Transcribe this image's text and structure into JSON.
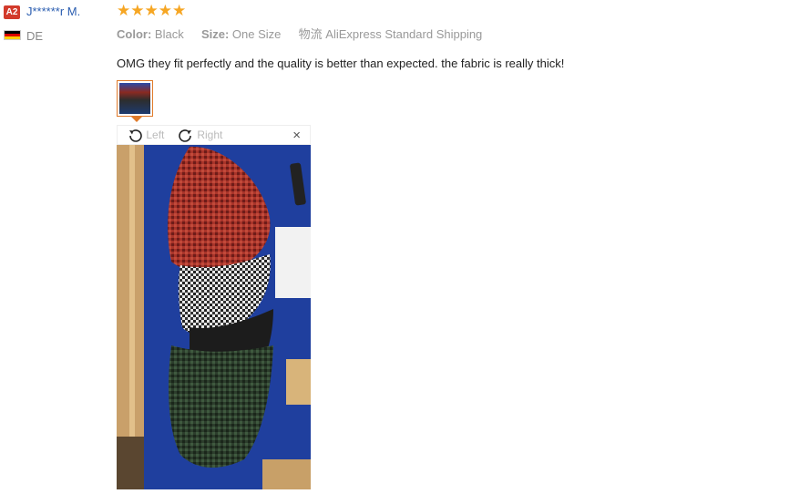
{
  "reviewer": {
    "level_badge": "A2",
    "name": "J******r M.",
    "country_code": "DE"
  },
  "rating": {
    "stars": 5,
    "max": 5,
    "star_color": "#f6a623"
  },
  "meta": {
    "color_label": "Color:",
    "color_value": "Black",
    "size_label": "Size:",
    "size_value": "One Size",
    "shipping_label": "物流",
    "shipping_value": "AliExpress Standard Shipping"
  },
  "review_text": "OMG they fit perfectly and the quality is better than expected. the fabric is really thick!",
  "viewer": {
    "rotate_left_label": "Left",
    "rotate_right_label": "Right",
    "close_label": "×"
  },
  "colors": {
    "accent_orange": "#e07b2a",
    "link_blue": "#2a5db0",
    "badge_red": "#d23a2b"
  }
}
